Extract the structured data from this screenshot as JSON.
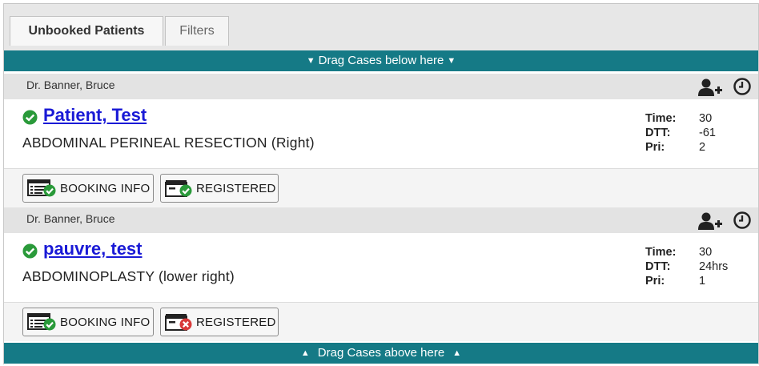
{
  "tabs": {
    "unbooked_label": "Unbooked Patients",
    "filters_label": "Filters"
  },
  "dropzones": {
    "top_label": "Drag Cases below here",
    "bottom_label": "Drag Cases above here"
  },
  "colors": {
    "accent": "#157a86",
    "status_ok": "#2a9a3a",
    "status_error": "#d83a3a",
    "link": "#1a1ad6"
  },
  "cases": [
    {
      "doctor": "Dr. Banner, Bruce",
      "patient_name": "Patient, Test",
      "procedure": "ABDOMINAL PERINEAL RESECTION (Right)",
      "time_label": "Time:",
      "time": "30",
      "dtt_label": "DTT:",
      "dtt": "-61",
      "pri_label": "Pri:",
      "pri": "2",
      "booking_info_label": "BOOKING INFO",
      "registered_label": "REGISTERED",
      "booking_status": "ok",
      "registered_status": "ok"
    },
    {
      "doctor": "Dr. Banner, Bruce",
      "patient_name": "pauvre, test",
      "procedure": "ABDOMINOPLASTY (lower right)",
      "time_label": "Time:",
      "time": "30",
      "dtt_label": "DTT:",
      "dtt": "24hrs",
      "pri_label": "Pri:",
      "pri": "1",
      "booking_info_label": "BOOKING INFO",
      "registered_label": "REGISTERED",
      "booking_status": "ok",
      "registered_status": "error"
    }
  ],
  "icons": [
    "add-user-icon",
    "clock-icon",
    "check-circle-icon",
    "booking-info-icon",
    "registered-ok-icon",
    "registered-error-icon",
    "caret-down-icon",
    "caret-up-icon"
  ]
}
